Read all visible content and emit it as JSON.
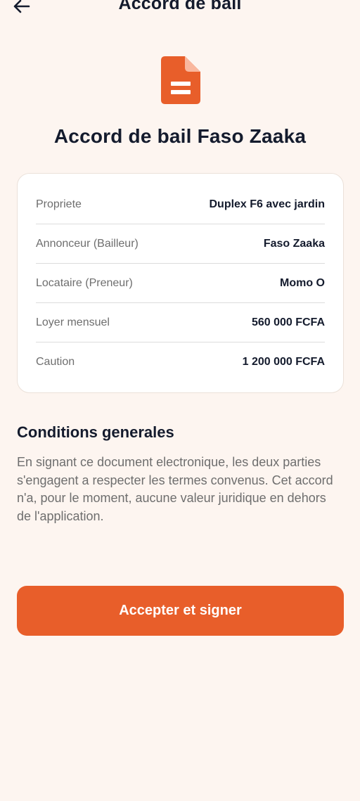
{
  "header": {
    "title": "Accord de bail",
    "back_icon": "arrow-left-icon"
  },
  "document_icon": "document-icon",
  "title": "Accord de bail Faso Zaaka",
  "details": [
    {
      "label": "Propriete",
      "value": "Duplex F6 avec jardin"
    },
    {
      "label": "Annonceur (Bailleur)",
      "value": "Faso Zaaka"
    },
    {
      "label": "Locataire (Preneur)",
      "value": "Momo O"
    },
    {
      "label": "Loyer mensuel",
      "value": "560 000 FCFA"
    },
    {
      "label": "Caution",
      "value": "1 200 000 FCFA"
    }
  ],
  "conditions": {
    "title": "Conditions generales",
    "text": "En signant ce document electronique, les deux parties s'engagent a respecter les termes convenus. Cet accord n'a, pour le moment, aucune valeur juridique en dehors de l'application."
  },
  "accept_button": {
    "label": "Accepter et signer"
  },
  "colors": {
    "accent": "#E85E2A",
    "background": "#FDF5F0",
    "text": "#141B2D",
    "muted": "#6E6E6E"
  }
}
